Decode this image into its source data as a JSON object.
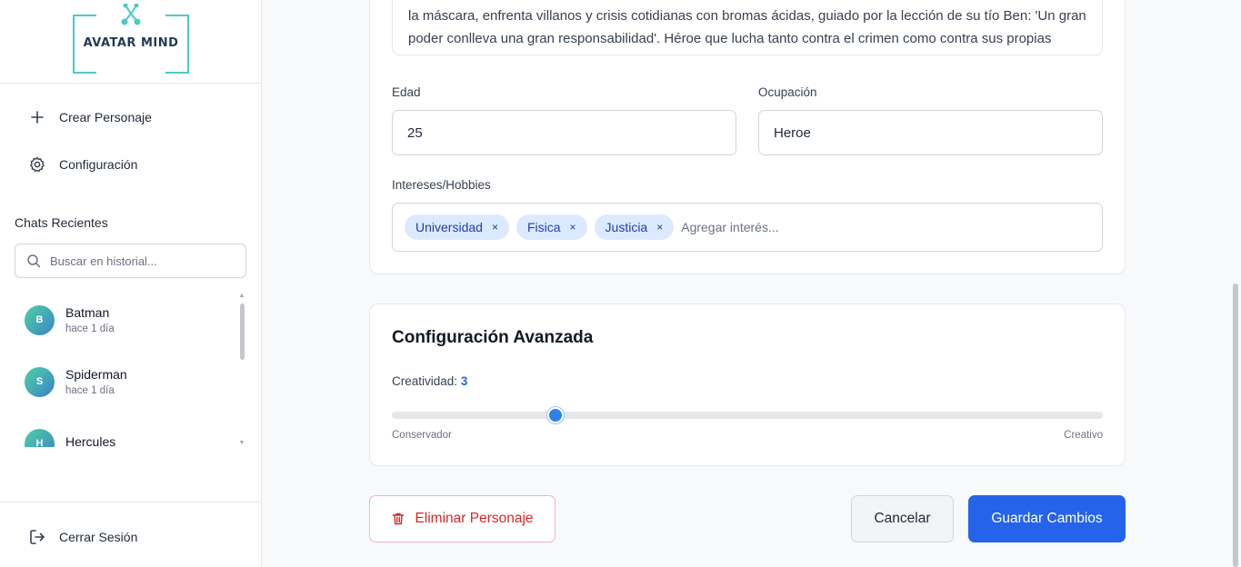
{
  "logo": {
    "text": "AVATAR MIND"
  },
  "nav": {
    "create": "Crear Personaje",
    "settings": "Configuración",
    "logout": "Cerrar Sesión"
  },
  "recent": {
    "title": "Chats Recientes",
    "search_placeholder": "Buscar en historial...",
    "items": [
      {
        "initial": "B",
        "name": "Batman",
        "time": "hace 1 día"
      },
      {
        "initial": "S",
        "name": "Spiderman",
        "time": "hace 1 día"
      },
      {
        "initial": "H",
        "name": "Hercules",
        "time": ""
      }
    ]
  },
  "form": {
    "description": "la máscara, enfrenta villanos y crisis cotidianas con bromas ácidas, guiado por la lección de su tío Ben: 'Un gran poder conlleva una gran responsabilidad'. Héroe que lucha tanto contra el crimen como contra sus propias dudas, porque incluso los elegidos no son perfectos.",
    "age_label": "Edad",
    "age_value": "25",
    "occupation_label": "Ocupación",
    "occupation_value": "Heroe",
    "interests_label": "Intereses/Hobbies",
    "interests": [
      "Universidad",
      "Fisica",
      "Justicia"
    ],
    "interest_remove": "×",
    "interest_placeholder": "Agregar interés..."
  },
  "advanced": {
    "title": "Configuración Avanzada",
    "creativity_label": "Creatividad:",
    "creativity_value": "3",
    "creativity_fraction": 0.23,
    "min_label": "Conservador",
    "max_label": "Creativo"
  },
  "actions": {
    "delete": "Eliminar Personaje",
    "cancel": "Cancelar",
    "save": "Guardar Cambios"
  },
  "colors": {
    "accent": "#2563eb",
    "danger": "#dc2626",
    "logo": "#4cc9c9"
  }
}
